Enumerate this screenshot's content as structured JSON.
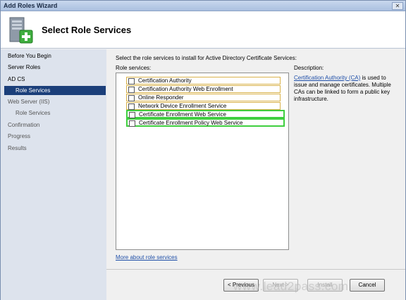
{
  "window": {
    "title": "Add Roles Wizard",
    "close_glyph": "✕"
  },
  "header": {
    "page_title": "Select Role Services"
  },
  "sidebar": {
    "items": [
      {
        "label": "Before You Begin"
      },
      {
        "label": "Server Roles"
      },
      {
        "label": "AD CS"
      },
      {
        "label": "Role Services"
      },
      {
        "label": "Web Server (IIS)"
      },
      {
        "label": "Role Services"
      },
      {
        "label": "Confirmation"
      },
      {
        "label": "Progress"
      },
      {
        "label": "Results"
      }
    ]
  },
  "main": {
    "instruction": "Select the role services to install for Active Directory Certificate Services:",
    "role_services_label": "Role services:",
    "role_services": [
      {
        "label": "Certification Authority",
        "checked": false
      },
      {
        "label": "Certification Authority Web Enrollment",
        "checked": false
      },
      {
        "label": "Online Responder",
        "checked": false
      },
      {
        "label": "Network Device Enrollment Service",
        "checked": false
      },
      {
        "label": "Certificate Enrollment Web Service",
        "checked": false
      },
      {
        "label": "Certificate Enrollment Policy Web Service",
        "checked": false
      }
    ],
    "description_label": "Description:",
    "description_link": "Certification Authority (CA)",
    "description_text": " is used to issue and manage certificates. Multiple CAs can be linked to form a public key infrastructure.",
    "more_link": "More about role services"
  },
  "footer": {
    "previous": "< Previous",
    "next": "Next >",
    "install": "Install",
    "cancel": "Cancel"
  },
  "watermark": "www.lead2pass.com",
  "colors": {
    "active_nav": "#1b3f7a",
    "highlight_gold": "#d9b24a",
    "highlight_green": "#3fcf3f",
    "link": "#1f4fa8"
  }
}
